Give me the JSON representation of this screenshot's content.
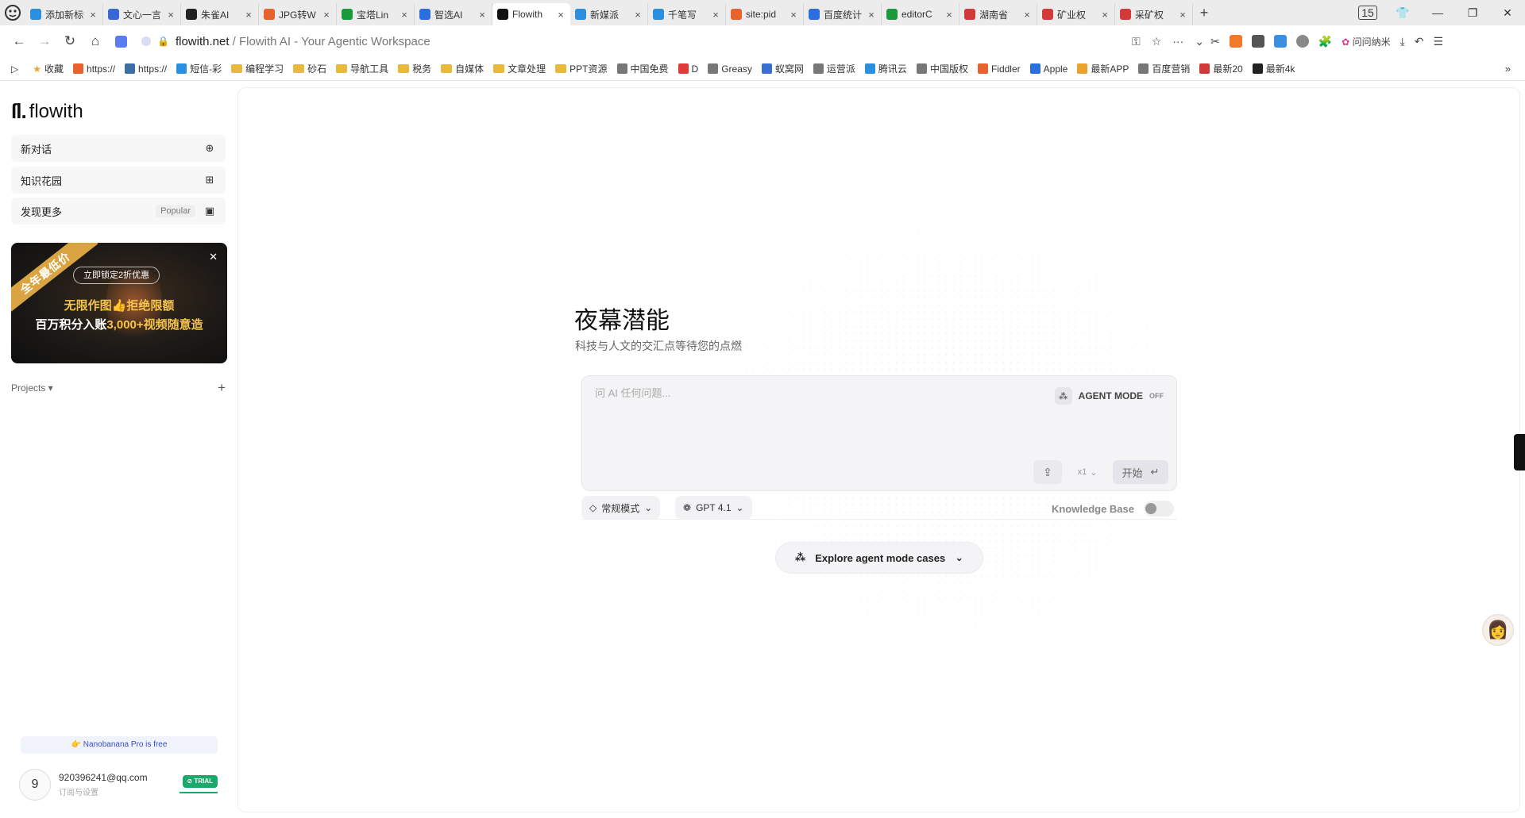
{
  "browser": {
    "tabs": [
      {
        "label": "添加新标签",
        "color": "#2b8fe0"
      },
      {
        "label": "文心一言",
        "color": "#3867d6"
      },
      {
        "label": "朱雀AI",
        "color": "#222222"
      },
      {
        "label": "JPG转W",
        "color": "#e8622d"
      },
      {
        "label": "宝塔Lin",
        "color": "#1a9a3a"
      },
      {
        "label": "智选AI",
        "color": "#2b6ee0"
      },
      {
        "label": "Flowith",
        "color": "#111111",
        "active": true
      },
      {
        "label": "新媒派",
        "color": "#2b8fe0"
      },
      {
        "label": "千笔写",
        "color": "#2b8fe0"
      },
      {
        "label": "site:pid",
        "color": "#e8622d"
      },
      {
        "label": "百度统计",
        "color": "#2b6ee0"
      },
      {
        "label": "editorC",
        "color": "#1a9a3a"
      },
      {
        "label": "湖南省",
        "color": "#d23a3a"
      },
      {
        "label": "矿业权",
        "color": "#d23a3a"
      },
      {
        "label": "采矿权",
        "color": "#d23a3a"
      }
    ],
    "tab_close": "×",
    "new_tab": "+",
    "tab_count": "15",
    "address_domain": "flowith.net",
    "address_rest": " / Flowith AI - Your Agentic Workspace",
    "profile_label": "问问纳米",
    "bookmarks": [
      {
        "label": "收藏",
        "kind": "star"
      },
      {
        "label": "https://",
        "kind": "icon",
        "color": "#e8622d"
      },
      {
        "label": "https://",
        "kind": "icon",
        "color": "#3c6ea8"
      },
      {
        "label": "短信-彩",
        "kind": "icon",
        "color": "#2b8fe0"
      },
      {
        "label": "编程学习",
        "kind": "folder"
      },
      {
        "label": "砂石",
        "kind": "folder"
      },
      {
        "label": "导航工具",
        "kind": "folder"
      },
      {
        "label": "税务",
        "kind": "folder"
      },
      {
        "label": "自媒体",
        "kind": "folder"
      },
      {
        "label": "文章处理",
        "kind": "folder"
      },
      {
        "label": "PPT资源",
        "kind": "folder"
      },
      {
        "label": "中国免费",
        "kind": "icon",
        "color": "#777777"
      },
      {
        "label": "D",
        "kind": "icon",
        "color": "#e03a3a"
      },
      {
        "label": "Greasy",
        "kind": "icon",
        "color": "#777777"
      },
      {
        "label": "蚁窝网",
        "kind": "icon",
        "color": "#3a6ed0"
      },
      {
        "label": "运营派",
        "kind": "icon",
        "color": "#777777"
      },
      {
        "label": "腾讯云",
        "kind": "icon",
        "color": "#2b8fe0"
      },
      {
        "label": "中国版权",
        "kind": "icon",
        "color": "#777777"
      },
      {
        "label": "Fiddler",
        "kind": "icon",
        "color": "#e8622d"
      },
      {
        "label": "Apple",
        "kind": "icon",
        "color": "#2b6ee0"
      },
      {
        "label": "最新APP",
        "kind": "icon",
        "color": "#e8a22d"
      },
      {
        "label": "百度营销",
        "kind": "icon",
        "color": "#777777"
      },
      {
        "label": "最新20",
        "kind": "icon",
        "color": "#d23a3a"
      },
      {
        "label": "最新4k",
        "kind": "icon",
        "color": "#222222"
      }
    ]
  },
  "sidebar": {
    "brand": "flowith",
    "brand_mark": "ſl.",
    "items": [
      {
        "label": "新对话",
        "badge": "",
        "icon": "new-chat-icon"
      },
      {
        "label": "知识花园",
        "badge": "",
        "icon": "garden-icon"
      },
      {
        "label": "发现更多",
        "badge": "Popular",
        "icon": "discover-icon"
      }
    ],
    "promo": {
      "ribbon": "全年最低价",
      "pill": "立即锁定2折优惠",
      "line1": "无限作图👍拒绝限额",
      "line2_prefix": "百万积分入账",
      "line2_highlight": "3,000+",
      "line2_suffix": "视频随意造"
    },
    "projects_label": "Projects ▾",
    "nano_notice": "👉 Nanobanana Pro is free",
    "user": {
      "avatar_initial": "9",
      "email": "920396241@qq.com",
      "subline": "订阅与设置",
      "badge": "⊘ TRIAL"
    }
  },
  "main": {
    "title": "夜幕潜能",
    "subtitle": "科技与人文的交汇点等待您的点燃",
    "composer": {
      "placeholder": "问 AI 任何问题...",
      "agent_mode_label": "AGENT MODE",
      "agent_mode_state": "OFF",
      "count_label": "x1",
      "start_label": "开始"
    },
    "mode_label": "常规模式",
    "model_label": "GPT 4.1",
    "knowledge_base_label": "Knowledge Base",
    "explore_label": "Explore agent mode cases"
  }
}
